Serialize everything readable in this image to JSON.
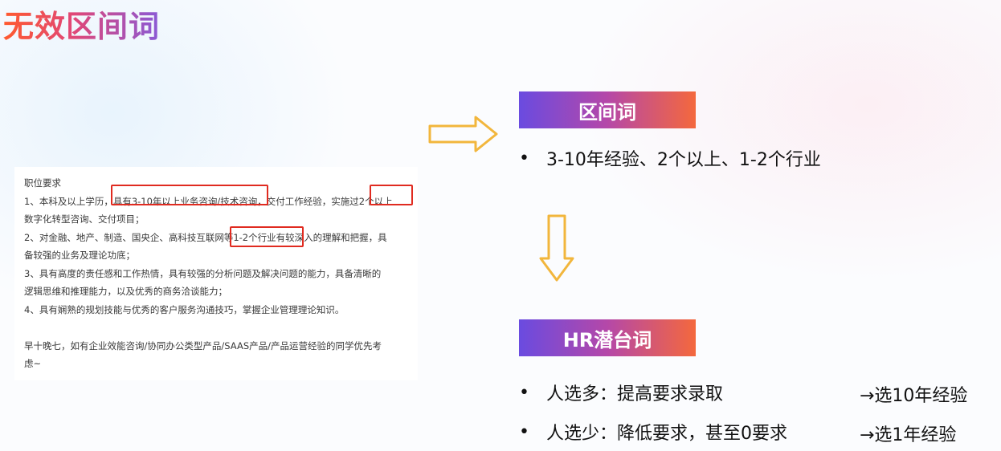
{
  "slide": {
    "title": "无效区间词"
  },
  "jd": {
    "lines": [
      "职位要求",
      "1、本科及以上学历，具有3-10年以上业务咨询/技术咨询，交付工作经验，实施过2个以上",
      "数字化转型咨询、交付项目；",
      "2、对金融、地产、制造、国央企、高科技互联网等1-2个行业有较深入的理解和把握，具",
      "备较强的业务及理论功底；",
      "3、具有高度的责任感和工作热情，具有较强的分析问题及解决问题的能力，具备清晰的",
      "逻辑思维和推理能力，以及优秀的商务洽谈能力；",
      "4、具有娴熟的规划技能与优秀的客户服务沟通技巧，掌握企业管理理论知识。",
      "",
      "早十晚七，如有企业效能咨询/协同办公类型产品/SAAS产品/产品运营经验的同学优先考",
      "虑~"
    ]
  },
  "interval": {
    "label": "区间词",
    "bullet": "•",
    "text": "3-10年经验、2个以上、1-2个行业"
  },
  "hr": {
    "label": "HR潜台词",
    "items": [
      {
        "bullet": "•",
        "text": "人选多：提高要求录取",
        "result": "→选10年经验"
      },
      {
        "bullet": "•",
        "text": "人选少：降低要求，甚至0要求",
        "result": "→选1年经验"
      }
    ]
  },
  "colors": {
    "highlight": "#e02b20",
    "arrow": "#f2b63c",
    "tag_start": "#6a4be0",
    "tag_end": "#f4683d"
  }
}
